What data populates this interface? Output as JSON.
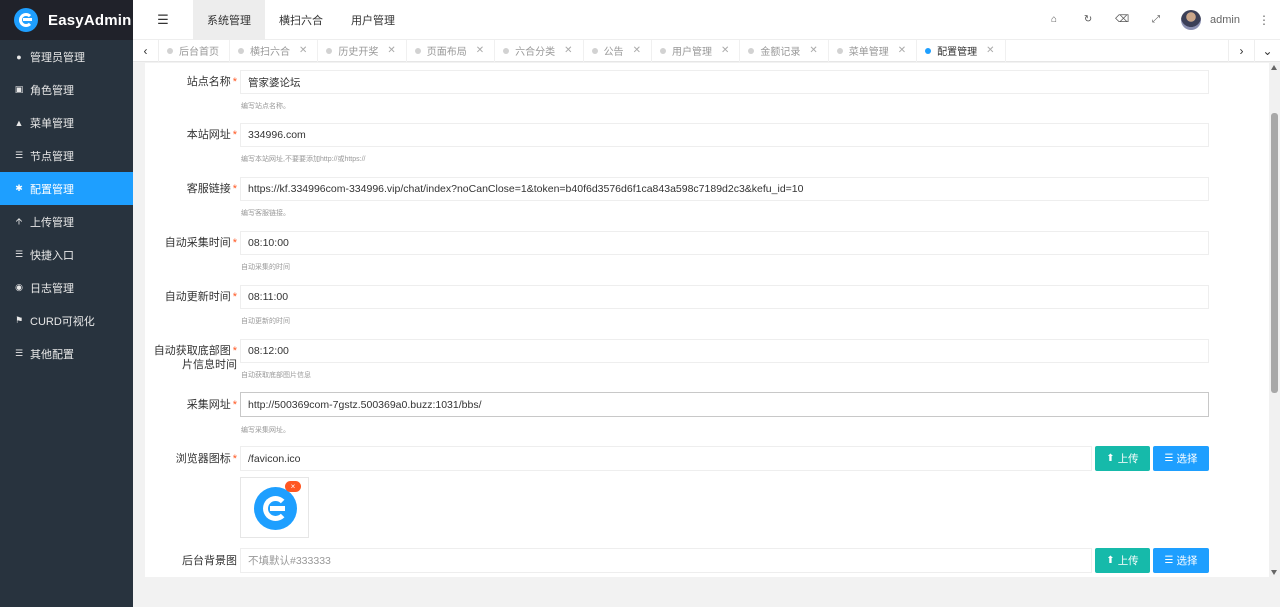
{
  "app": {
    "title": "EasyAdmin"
  },
  "sidebar": {
    "items": [
      {
        "label": "管理员管理",
        "icon": "user-icon",
        "active": false
      },
      {
        "label": "角色管理",
        "icon": "role-icon",
        "active": false
      },
      {
        "label": "菜单管理",
        "icon": "tree-icon",
        "active": false
      },
      {
        "label": "节点管理",
        "icon": "list-icon",
        "active": false
      },
      {
        "label": "配置管理",
        "icon": "gear-icon",
        "active": true
      },
      {
        "label": "上传管理",
        "icon": "arrow-up-icon",
        "active": false
      },
      {
        "label": "快捷入口",
        "icon": "list-icon",
        "active": false
      },
      {
        "label": "日志管理",
        "icon": "globe-icon",
        "active": false
      },
      {
        "label": "CURD可视化",
        "icon": "flag-icon",
        "active": false
      },
      {
        "label": "其他配置",
        "icon": "list-icon",
        "active": false
      }
    ]
  },
  "header": {
    "nav": [
      {
        "label": "系统管理",
        "active": true
      },
      {
        "label": "横扫六合",
        "active": false
      },
      {
        "label": "用户管理",
        "active": false
      }
    ],
    "user": "admin"
  },
  "tabs": [
    {
      "label": "后台首页",
      "closable": false,
      "active": false
    },
    {
      "label": "横扫六合",
      "closable": true,
      "active": false
    },
    {
      "label": "历史开奖",
      "closable": true,
      "active": false
    },
    {
      "label": "页面布局",
      "closable": true,
      "active": false
    },
    {
      "label": "六合分类",
      "closable": true,
      "active": false
    },
    {
      "label": "公告",
      "closable": true,
      "active": false
    },
    {
      "label": "用户管理",
      "closable": true,
      "active": false
    },
    {
      "label": "金额记录",
      "closable": true,
      "active": false
    },
    {
      "label": "菜单管理",
      "closable": true,
      "active": false
    },
    {
      "label": "配置管理",
      "closable": true,
      "active": true
    }
  ],
  "form": {
    "site_name": {
      "label": "站点名称",
      "value": "管家婆论坛",
      "tip": "编写站点名称。"
    },
    "site_url": {
      "label": "本站网址",
      "value": "334996.com",
      "tip": "编写本站网址,不要要添加http://或https://"
    },
    "service_link": {
      "label": "客服链接",
      "value": "https://kf.334996com-334996.vip/chat/index?noCanClose=1&token=b40f6d3576d6f1ca843a598c7189d2c3&kefu_id=10",
      "tip": "编写客服链接。"
    },
    "auto_collect_time": {
      "label": "自动采集时间",
      "value": "08:10:00",
      "tip": "自动采集的时间"
    },
    "auto_update_time": {
      "label": "自动更新时间",
      "value": "08:11:00",
      "tip": "自动更新的时间"
    },
    "auto_fetch_time": {
      "label_line1": "自动获取底部图",
      "label_line2": "片信息时间",
      "value": "08:12:00",
      "tip": "自动获取底部图片信息"
    },
    "collect_url": {
      "label": "采集网址",
      "value": "http://500369com-7gstz.500369a0.buzz:1031/bbs/",
      "tip": "编写采集网址。"
    },
    "favicon": {
      "label": "浏览器图标",
      "value": "/favicon.ico",
      "delete_mark": "×"
    },
    "bg_image": {
      "label": "后台背景图",
      "placeholder": "不填默认#333333"
    },
    "upload_label": "上传",
    "select_label": "选择",
    "required_mark": "*"
  },
  "colors": {
    "primary": "#1e9fff",
    "teal": "#16baaa",
    "sidebar": "#28333e",
    "danger": "#ff5722"
  }
}
